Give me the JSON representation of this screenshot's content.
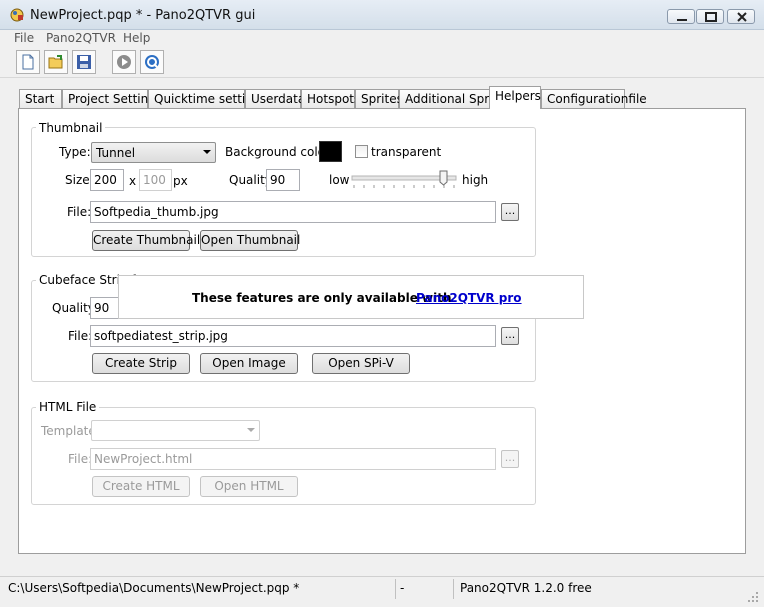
{
  "window": {
    "title": "NewProject.pqp * - Pano2QTVR gui"
  },
  "menu": [
    "File",
    "Pano2QTVR",
    "Help"
  ],
  "toolbar": {
    "buttons": [
      "new-document-icon",
      "open-folder-icon",
      "save-disk-icon",
      "play-icon",
      "qtvr-preview-icon"
    ]
  },
  "tabs": [
    {
      "label": "Start"
    },
    {
      "label": "Project Settings"
    },
    {
      "label": "Quicktime settings"
    },
    {
      "label": "Userdata"
    },
    {
      "label": "Hotspots"
    },
    {
      "label": "Sprites"
    },
    {
      "label": "Additional Sprites"
    },
    {
      "label": "Helpers",
      "active": true
    },
    {
      "label": "Configurationfile"
    }
  ],
  "thumbnail": {
    "group_label": "Thumbnail",
    "type_label": "Type:",
    "type_value": "Tunnel",
    "bg_color_label": "Background color:",
    "bg_color": "#000000",
    "transparent_label": "transparent",
    "transparent_checked": false,
    "size_label": "Size:",
    "width": "200",
    "x_label": "x",
    "height": "100",
    "px_label": "px",
    "quality_label": "Quality:",
    "quality": "90",
    "low_label": "low",
    "high_label": "high",
    "slider_fraction": 0.9,
    "file_label": "File:",
    "file_value": "Softpedia_thumb.jpg",
    "browse_label": "...",
    "create_button": "Create Thumbnail",
    "open_button": "Open Thumbnail"
  },
  "cubeface": {
    "group_label": "Cubeface Strip fo",
    "quality_label": "Quality:",
    "quality": "90",
    "file_label": "File:",
    "file_value": "softpediatest_strip.jpg",
    "browse_label": "...",
    "create_button": "Create Strip",
    "open_image_button": "Open Image",
    "open_spiv_button": "Open SPi-V"
  },
  "overlay": {
    "text": "These features are only available with",
    "link": "Pano2QTVR pro"
  },
  "html_file": {
    "group_label": "HTML File",
    "template_label": "Template:",
    "template_value": "",
    "file_label": "File:",
    "file_value": "NewProject.html",
    "browse_label": "...",
    "create_button": "Create HTML",
    "open_button": "Open HTML"
  },
  "status": {
    "path": "C:\\Users\\Softpedia\\Documents\\NewProject.pqp *",
    "middle": "-",
    "version": "Pano2QTVR 1.2.0 free"
  },
  "colors": {
    "window_bg": "#f0f0f0",
    "link": "#0000cc",
    "swatch": "#000000"
  }
}
